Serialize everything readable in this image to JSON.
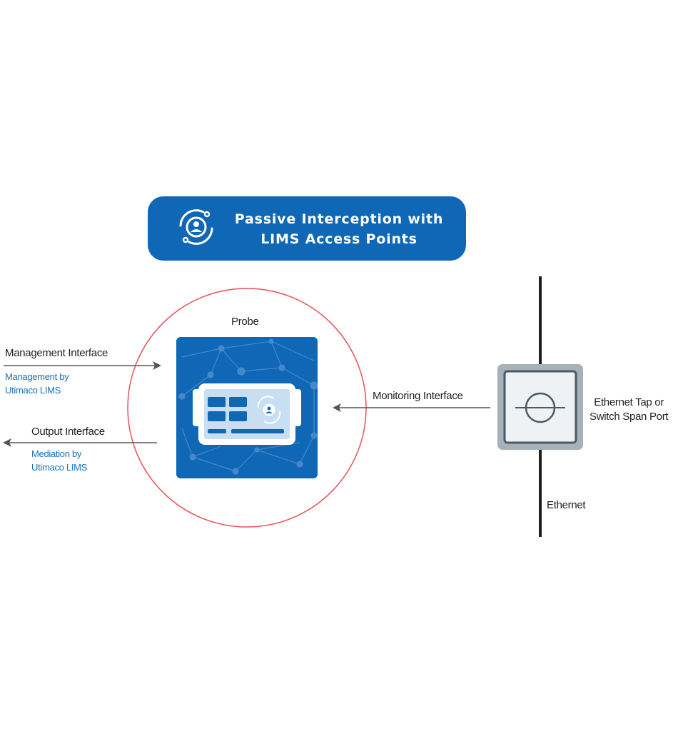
{
  "banner": {
    "title": "Passive Interception with\nLIMS Access Points"
  },
  "probe": {
    "label": "Probe"
  },
  "management": {
    "label": "Management Interface",
    "note_line1": "Management by",
    "note_line2": "Utimaco LIMS"
  },
  "output": {
    "label": "Output Interface",
    "note_line1": "Mediation by",
    "note_line2": "Utimaco LIMS"
  },
  "monitoring": {
    "label": "Monitoring Interface"
  },
  "tap": {
    "label_line1": "Ethernet Tap or",
    "label_line2": "Switch Span Port"
  },
  "ethernet": {
    "label": "Ethernet"
  },
  "colors": {
    "brand_blue": "#0f67b5",
    "circle_outline": "#e8505b",
    "note_text": "#1a6fbd",
    "arrow": "#555555"
  }
}
